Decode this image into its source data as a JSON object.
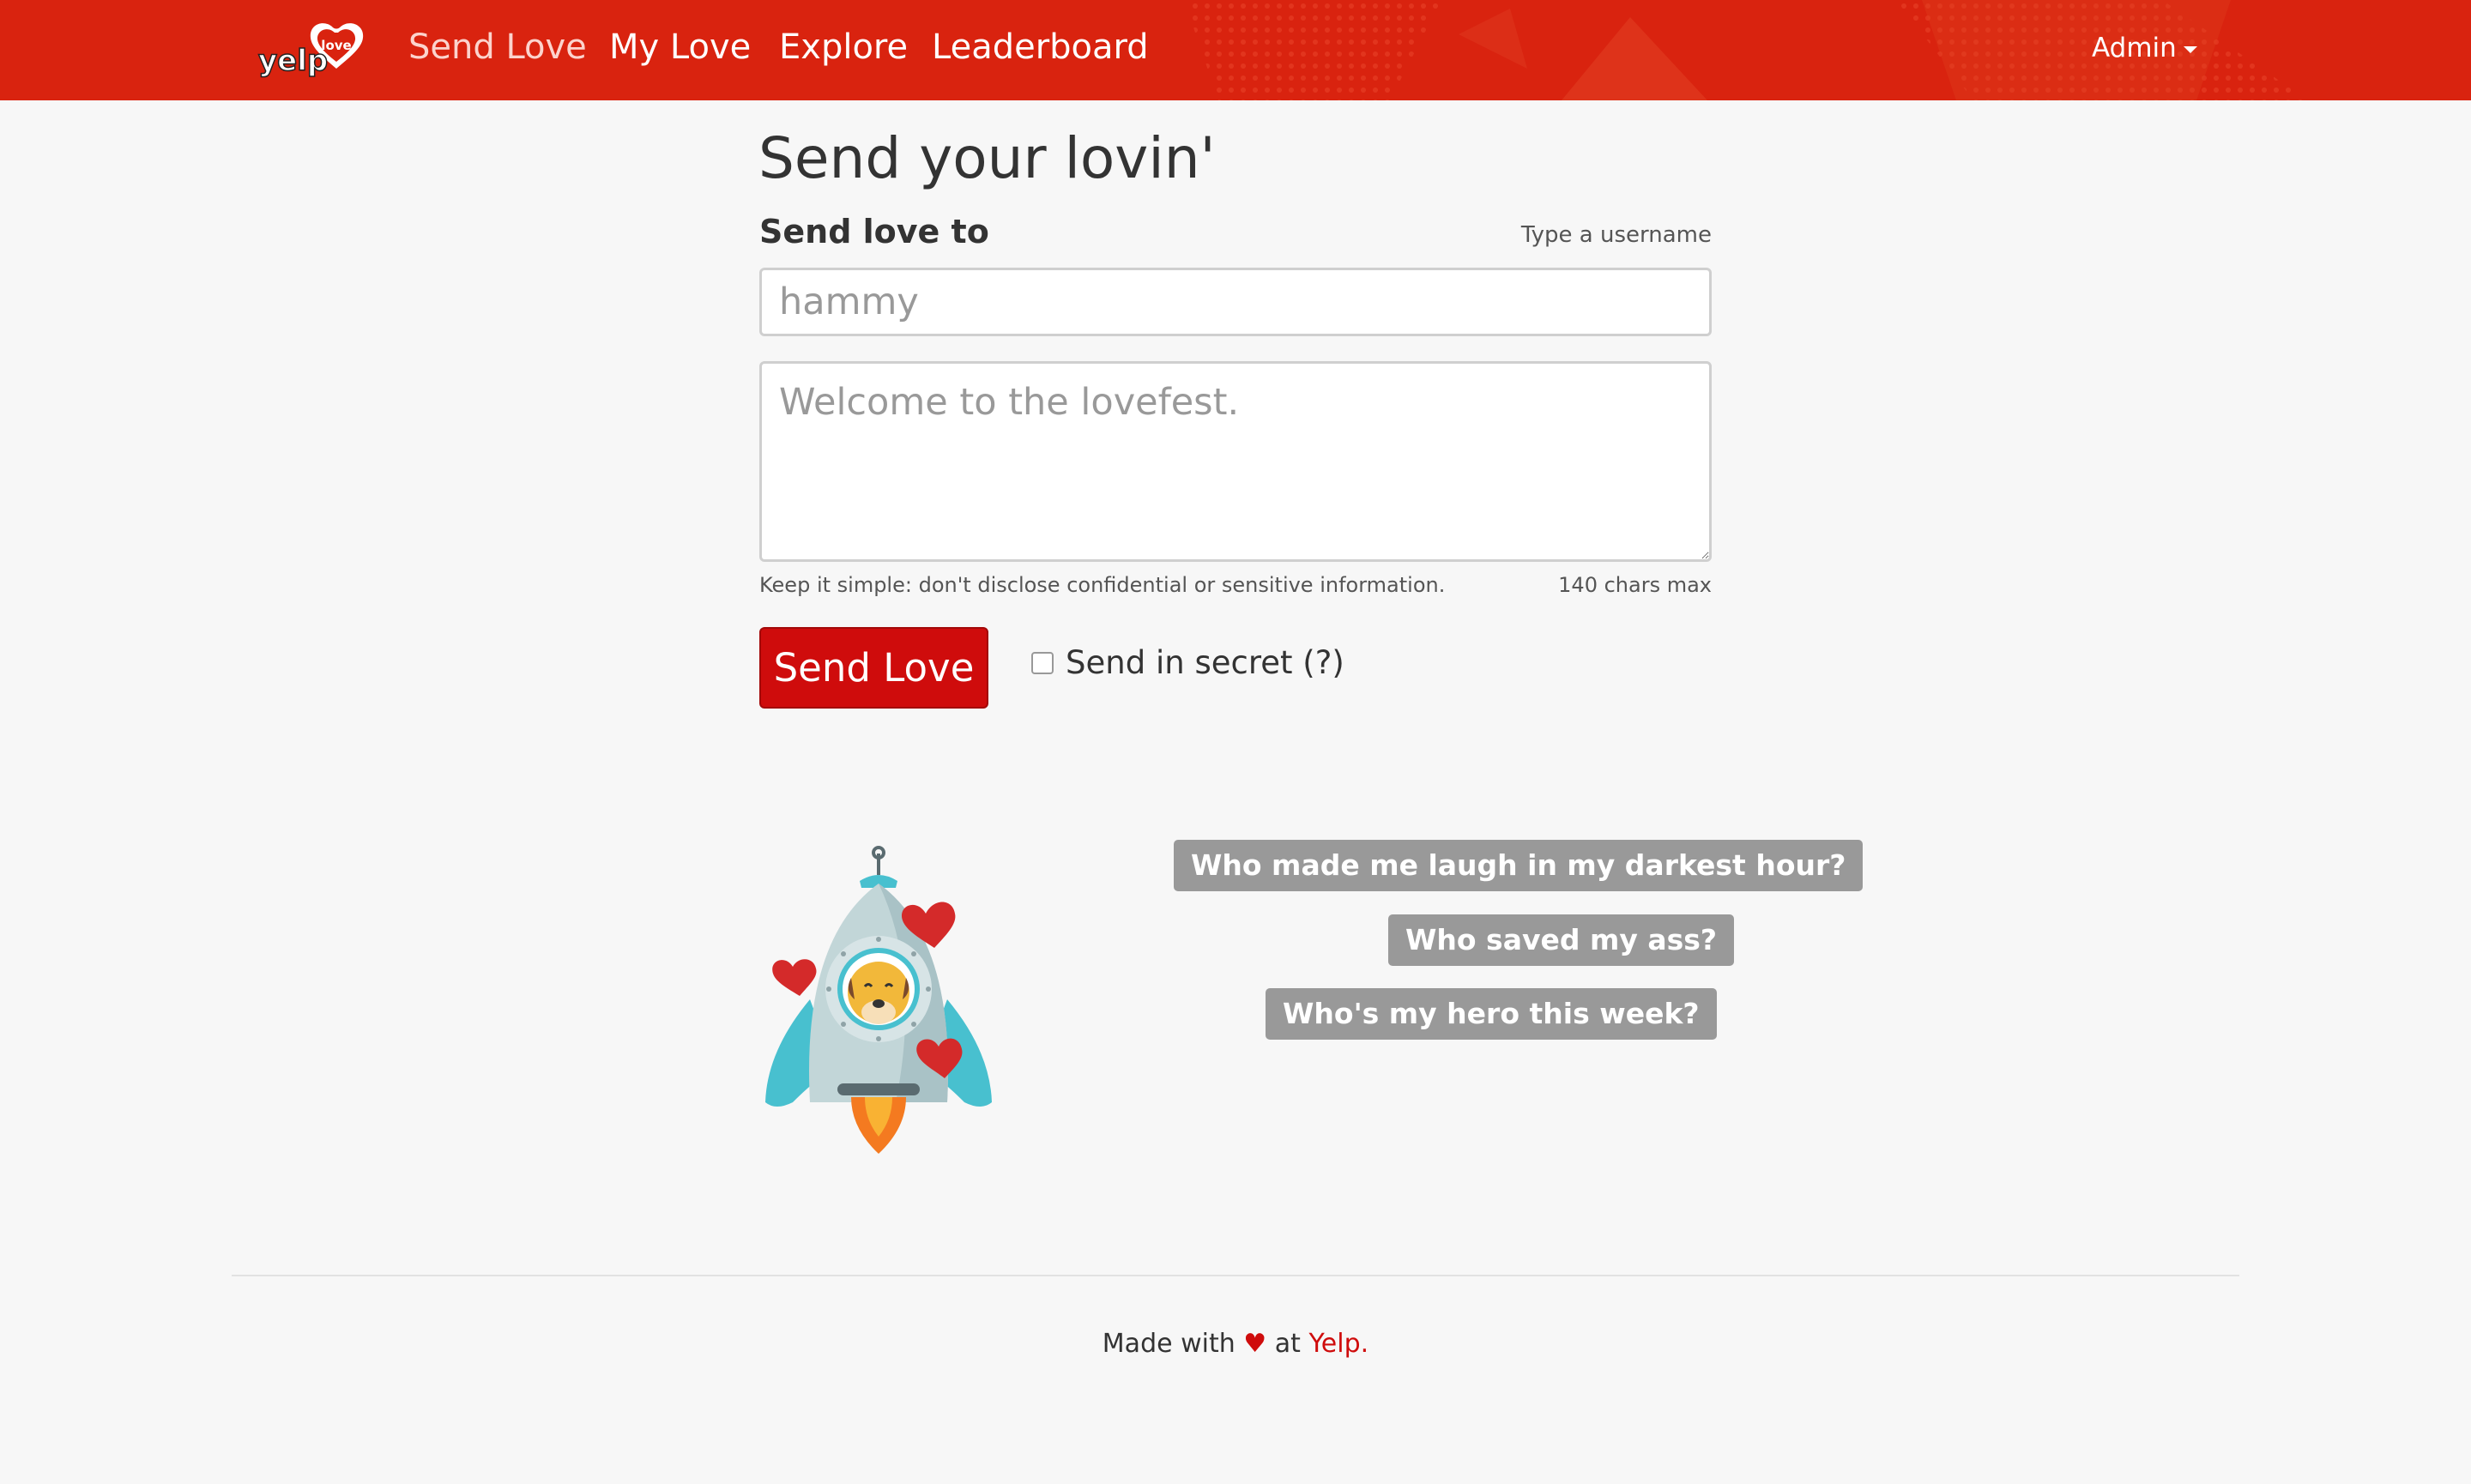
{
  "navbar": {
    "logo_text": "yelp",
    "logo_badge": "love",
    "links": [
      {
        "label": "Send Love",
        "active": true
      },
      {
        "label": "My Love",
        "active": false
      },
      {
        "label": "Explore",
        "active": false
      },
      {
        "label": "Leaderboard",
        "active": false
      }
    ],
    "user_menu": "Admin",
    "background_color": "#d9230f"
  },
  "form": {
    "title": "Send your lovin'",
    "recipient_label": "Send love to",
    "recipient_hint": "Type a username",
    "recipient_placeholder": "hammy",
    "message_placeholder": "Welcome to the lovefest.",
    "help_text": "Keep it simple: don't disclose confidential or sensitive information.",
    "char_limit": "140 chars max",
    "submit_label": "Send Love",
    "secret_label": "Send in secret (?)",
    "secret_checked": false,
    "button_color": "#cf0c0c"
  },
  "prompts": [
    "Who made me laugh in my darkest hour?",
    "Who saved my ass?",
    "Who's my hero this week?"
  ],
  "illustration": "rocket-with-hearts",
  "footer": {
    "prefix": "Made with",
    "heart": "♥",
    "middle": "at",
    "link": "Yelp",
    "suffix": "."
  }
}
